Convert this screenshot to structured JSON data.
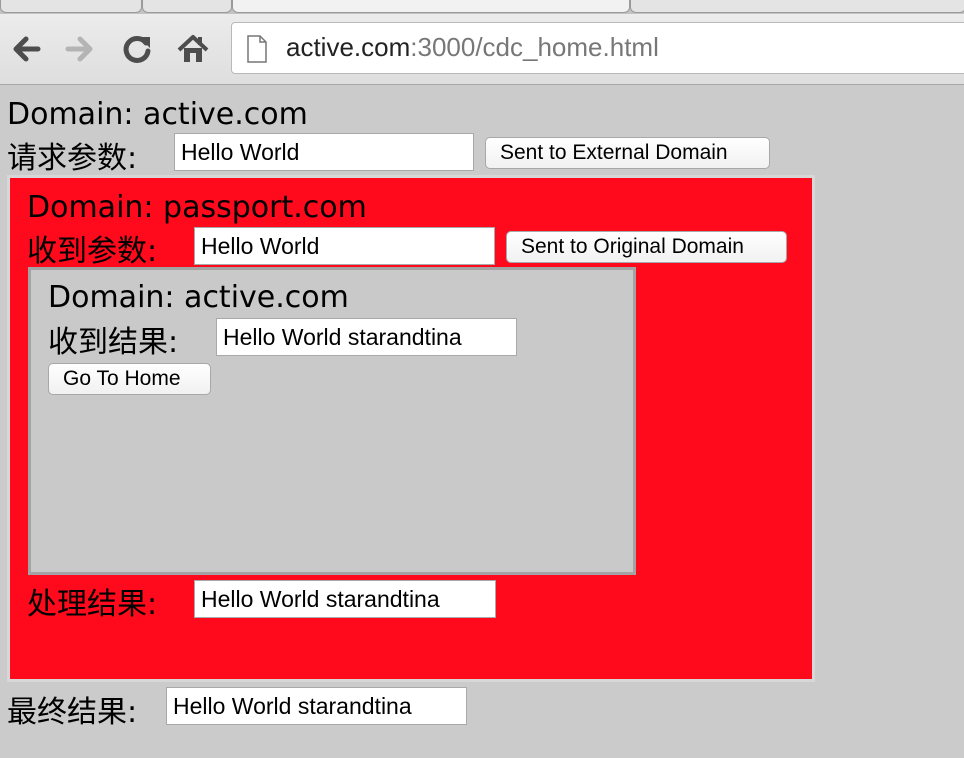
{
  "browser": {
    "url_host": "active.com",
    "url_path": ":3000/cdc_home.html"
  },
  "outer": {
    "domain": "Domain: active.com",
    "request_label": "请求参数:",
    "request_value": "Hello World",
    "send_button": "Sent to External Domain",
    "final_label": "最终结果:",
    "final_value": "Hello World starandtina"
  },
  "passport_frame": {
    "domain": "Domain: passport.com",
    "received_label": "收到参数:",
    "received_value": "Hello World",
    "send_back_button": "Sent to Original Domain",
    "processed_label": "处理结果:",
    "processed_value": "Hello World starandtina",
    "bg_color": "#fe0a1c"
  },
  "inner_frame": {
    "domain": "Domain: active.com",
    "result_label": "收到结果:",
    "result_value": "Hello World starandtina",
    "home_button": "Go To Home"
  }
}
